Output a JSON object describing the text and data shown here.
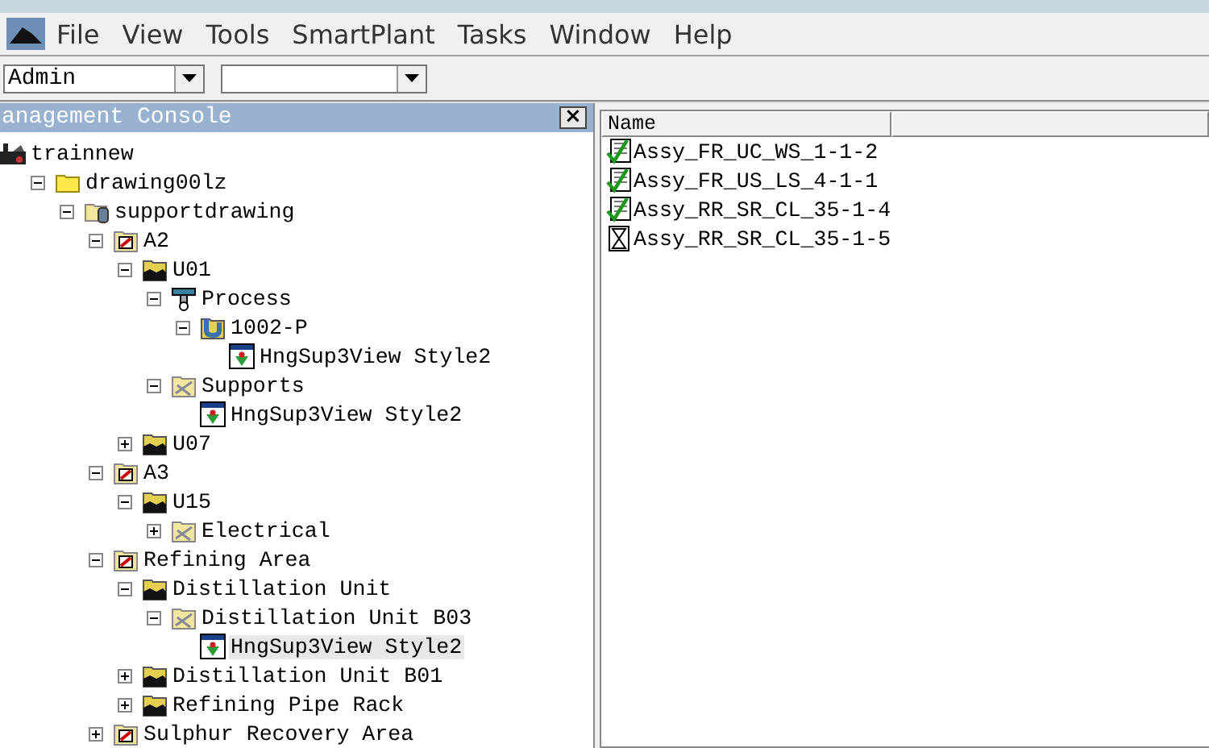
{
  "menu": [
    "File",
    "View",
    "Tools",
    "SmartPlant",
    "Tasks",
    "Window",
    "Help"
  ],
  "toolbar": {
    "user": "Admin"
  },
  "console": {
    "title": "anagement Console",
    "close": "×",
    "tree": [
      {
        "label": "trainnew",
        "kind": "plant",
        "selected": false,
        "children": [
          {
            "label": "drawing00lz",
            "kind": "folder",
            "expanded": true,
            "selected": false,
            "children": [
              {
                "label": "supportdrawing",
                "kind": "dbfolder",
                "expanded": true,
                "selected": false,
                "children": [
                  {
                    "label": "A2",
                    "kind": "area",
                    "expanded": true,
                    "selected": false,
                    "children": [
                      {
                        "label": "U01",
                        "kind": "unit",
                        "expanded": true,
                        "selected": false,
                        "children": [
                          {
                            "label": "Process",
                            "kind": "process",
                            "expanded": true,
                            "selected": false,
                            "children": [
                              {
                                "label": "1002-P",
                                "kind": "pipe",
                                "expanded": true,
                                "selected": false,
                                "children": [
                                  {
                                    "label": "HngSup3View Style2",
                                    "kind": "view",
                                    "selected": false
                                  }
                                ]
                              }
                            ]
                          },
                          {
                            "label": "Supports",
                            "kind": "supports",
                            "expanded": true,
                            "selected": false,
                            "children": [
                              {
                                "label": "HngSup3View Style2",
                                "kind": "view",
                                "selected": false
                              }
                            ]
                          }
                        ]
                      },
                      {
                        "label": "U07",
                        "kind": "unit",
                        "expanded": false,
                        "selected": false
                      }
                    ]
                  },
                  {
                    "label": "A3",
                    "kind": "area",
                    "expanded": true,
                    "selected": false,
                    "children": [
                      {
                        "label": "U15",
                        "kind": "unit",
                        "expanded": true,
                        "selected": false,
                        "children": [
                          {
                            "label": "Electrical",
                            "kind": "supports",
                            "expanded": false,
                            "selected": false
                          }
                        ]
                      }
                    ]
                  },
                  {
                    "label": "Refining Area",
                    "kind": "area",
                    "expanded": true,
                    "selected": false,
                    "children": [
                      {
                        "label": "Distillation Unit",
                        "kind": "unit",
                        "expanded": true,
                        "selected": false,
                        "children": [
                          {
                            "label": "Distillation Unit B03",
                            "kind": "supports",
                            "expanded": true,
                            "selected": false,
                            "children": [
                              {
                                "label": "HngSup3View Style2",
                                "kind": "view",
                                "selected": true
                              }
                            ]
                          }
                        ]
                      },
                      {
                        "label": "Distillation Unit B01",
                        "kind": "unit",
                        "expanded": false,
                        "selected": false
                      },
                      {
                        "label": "Refining Pipe Rack",
                        "kind": "unit",
                        "expanded": false,
                        "selected": false
                      }
                    ]
                  },
                  {
                    "label": "Sulphur Recovery Area",
                    "kind": "area",
                    "expanded": false,
                    "selected": false
                  }
                ]
              }
            ]
          }
        ]
      }
    ]
  },
  "list": {
    "columns": [
      "Name"
    ],
    "rows": [
      {
        "name": "Assy_FR_UC_WS_1-1-2",
        "kind": "done"
      },
      {
        "name": "Assy_FR_US_LS_4-1-1",
        "kind": "done"
      },
      {
        "name": "Assy_RR_SR_CL_35-1-4",
        "kind": "done"
      },
      {
        "name": "Assy_RR_SR_CL_35-1-5",
        "kind": "pending"
      }
    ]
  }
}
